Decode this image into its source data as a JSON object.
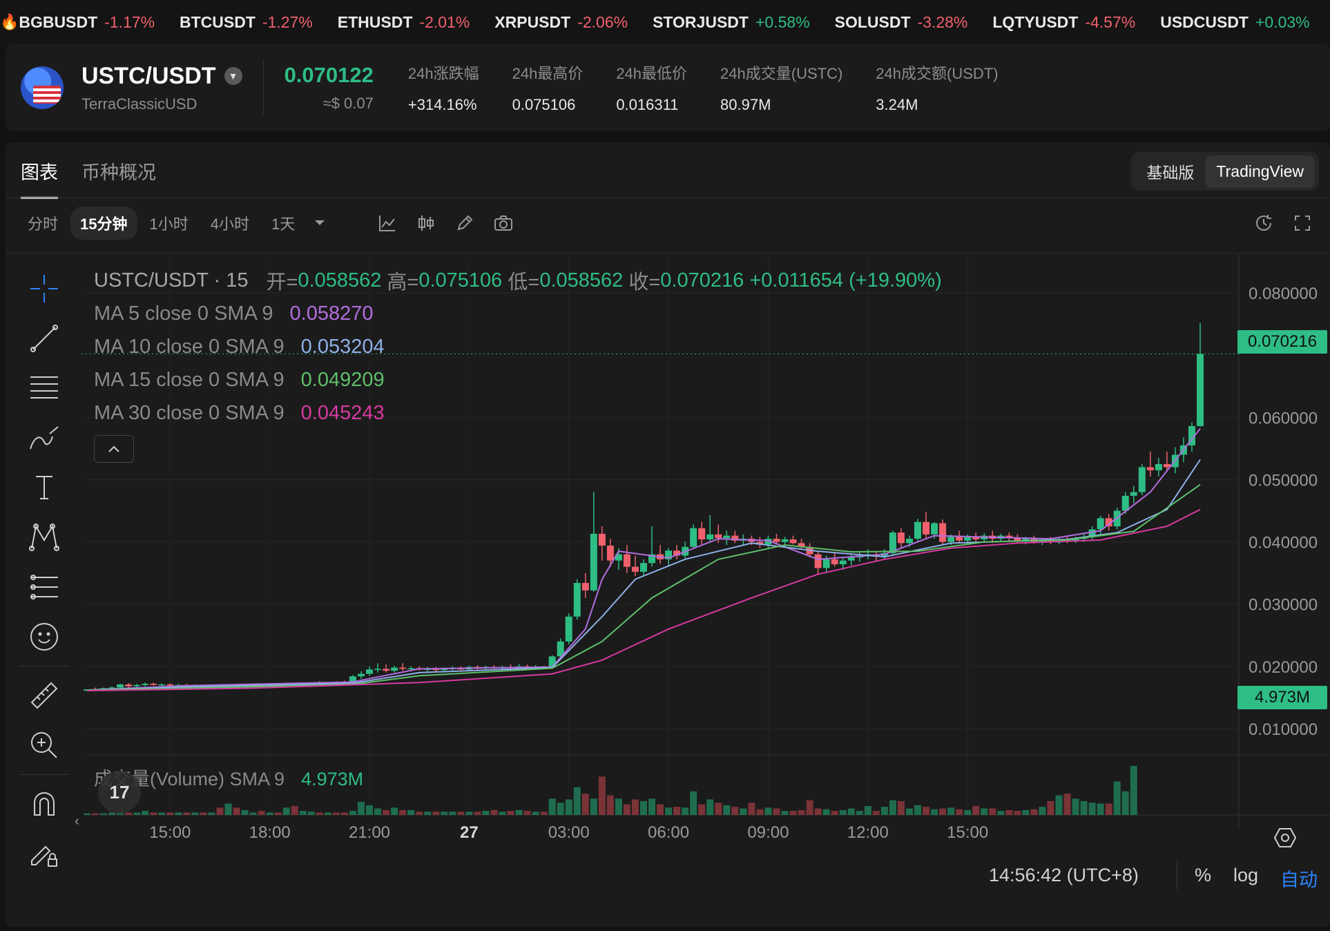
{
  "ticker": [
    {
      "symbol": "BGBUSDT",
      "change": "-1.17%",
      "dir": "down"
    },
    {
      "symbol": "BTCUSDT",
      "change": "-1.27%",
      "dir": "down"
    },
    {
      "symbol": "ETHUSDT",
      "change": "-2.01%",
      "dir": "down"
    },
    {
      "symbol": "XRPUSDT",
      "change": "-2.06%",
      "dir": "down"
    },
    {
      "symbol": "STORJUSDT",
      "change": "+0.58%",
      "dir": "up"
    },
    {
      "symbol": "SOLUSDT",
      "change": "-3.28%",
      "dir": "down"
    },
    {
      "symbol": "LQTYUSDT",
      "change": "-4.57%",
      "dir": "down"
    },
    {
      "symbol": "USDCUSDT",
      "change": "+0.03%",
      "dir": "up"
    }
  ],
  "header": {
    "pair": "USTC/USDT",
    "name": "TerraClassicUSD",
    "price": "0.070122",
    "price_usd": "≈$ 0.07",
    "stats": [
      {
        "label": "24h涨跌幅",
        "value": "+314.16%",
        "color": "up"
      },
      {
        "label": "24h最高价",
        "value": "0.075106"
      },
      {
        "label": "24h最低价",
        "value": "0.016311"
      },
      {
        "label": "24h成交量(USTC)",
        "value": "80.97M"
      },
      {
        "label": "24h成交额(USDT)",
        "value": "3.24M"
      }
    ]
  },
  "tabs": [
    "图表",
    "币种概况"
  ],
  "view_toggle": [
    "基础版",
    "TradingView"
  ],
  "intervals": [
    "分时",
    "15分钟",
    "1小时",
    "4小时",
    "1天"
  ],
  "legend": {
    "title": "USTC/USDT · 15",
    "ohlc": {
      "open_label": "开=",
      "open": "0.058562",
      "high_label": "高=",
      "high": "0.075106",
      "low_label": "低=",
      "low": "0.058562",
      "close_label": "收=",
      "close": "0.070216",
      "change": "+0.011654 (+19.90%)"
    },
    "mas": [
      {
        "label": "MA 5 close 0 SMA 9",
        "value": "0.058270",
        "color": "#b36ee0"
      },
      {
        "label": "MA 10 close 0 SMA 9",
        "value": "0.053204",
        "color": "#8fb0e8"
      },
      {
        "label": "MA 15 close 0 SMA 9",
        "value": "0.049209",
        "color": "#5fbf6a"
      },
      {
        "label": "MA 30 close 0 SMA 9",
        "value": "0.045243",
        "color": "#d63aa0"
      }
    ]
  },
  "volume_legend": {
    "label": "成交量(Volume) SMA 9",
    "value": "4.973M"
  },
  "price_tag": "0.070216",
  "volume_tag": "4.973M",
  "y_ticks": [
    "0.080000",
    "0.060000",
    "0.050000",
    "0.040000",
    "0.030000",
    "0.020000",
    "0.010000"
  ],
  "x_ticks": [
    "15:00",
    "18:00",
    "21:00",
    "27",
    "03:00",
    "06:00",
    "09:00",
    "12:00",
    "15:00"
  ],
  "bottom": {
    "time": "14:56:42 (UTC+8)",
    "percent": "%",
    "log": "log",
    "auto": "自动"
  },
  "chart_data": {
    "type": "candlestick",
    "ylim": [
      0.008,
      0.084
    ],
    "ticks": [
      0.08,
      0.06,
      0.05,
      0.04,
      0.03,
      0.02,
      0.01
    ],
    "candles": [
      [
        0.0161,
        0.0163,
        0.016,
        0.0163
      ],
      [
        0.0163,
        0.0166,
        0.016,
        0.0162
      ],
      [
        0.0162,
        0.0166,
        0.016,
        0.0165
      ],
      [
        0.0165,
        0.0168,
        0.0162,
        0.0166
      ],
      [
        0.0166,
        0.0172,
        0.0164,
        0.0171
      ],
      [
        0.0171,
        0.0173,
        0.0166,
        0.0168
      ],
      [
        0.0168,
        0.0172,
        0.0166,
        0.017
      ],
      [
        0.017,
        0.0174,
        0.0168,
        0.0172
      ],
      [
        0.0172,
        0.0174,
        0.0169,
        0.017
      ],
      [
        0.017,
        0.0173,
        0.0168,
        0.0171
      ],
      [
        0.0171,
        0.0173,
        0.0168,
        0.0169
      ],
      [
        0.0169,
        0.0172,
        0.0167,
        0.017
      ],
      [
        0.017,
        0.0172,
        0.0167,
        0.0168
      ],
      [
        0.0168,
        0.0171,
        0.0166,
        0.0169
      ],
      [
        0.0169,
        0.0171,
        0.0166,
        0.0167
      ],
      [
        0.0167,
        0.017,
        0.0165,
        0.0168
      ],
      [
        0.0168,
        0.017,
        0.0165,
        0.0166
      ],
      [
        0.0166,
        0.0169,
        0.0164,
        0.0167
      ],
      [
        0.0167,
        0.0169,
        0.0165,
        0.0166
      ],
      [
        0.0166,
        0.0169,
        0.0164,
        0.0168
      ],
      [
        0.0168,
        0.0171,
        0.0165,
        0.0169
      ],
      [
        0.0169,
        0.0171,
        0.0166,
        0.0167
      ],
      [
        0.0167,
        0.0172,
        0.0166,
        0.0171
      ],
      [
        0.0171,
        0.0173,
        0.0168,
        0.017
      ],
      [
        0.017,
        0.0174,
        0.0168,
        0.0172
      ],
      [
        0.0172,
        0.0174,
        0.0169,
        0.017
      ],
      [
        0.017,
        0.0173,
        0.0168,
        0.0171
      ],
      [
        0.0171,
        0.0174,
        0.0169,
        0.0173
      ],
      [
        0.0173,
        0.0176,
        0.017,
        0.0172
      ],
      [
        0.0172,
        0.0175,
        0.017,
        0.0174
      ],
      [
        0.0174,
        0.0176,
        0.0171,
        0.0173
      ],
      [
        0.0173,
        0.0177,
        0.017,
        0.0172
      ],
      [
        0.0172,
        0.0186,
        0.017,
        0.0184
      ],
      [
        0.0184,
        0.0192,
        0.018,
        0.0188
      ],
      [
        0.0188,
        0.02,
        0.0185,
        0.0195
      ],
      [
        0.0195,
        0.0205,
        0.019,
        0.0196
      ],
      [
        0.0196,
        0.0203,
        0.019,
        0.0193
      ],
      [
        0.0193,
        0.0201,
        0.019,
        0.0198
      ],
      [
        0.0198,
        0.0205,
        0.0193,
        0.0196
      ],
      [
        0.0196,
        0.02,
        0.0192,
        0.0197
      ],
      [
        0.0197,
        0.02,
        0.0193,
        0.0195
      ],
      [
        0.0195,
        0.0199,
        0.0192,
        0.0196
      ],
      [
        0.0196,
        0.0199,
        0.0192,
        0.0194
      ],
      [
        0.0194,
        0.0198,
        0.0191,
        0.0196
      ],
      [
        0.0196,
        0.02,
        0.0193,
        0.0197
      ],
      [
        0.0197,
        0.02,
        0.0194,
        0.0195
      ],
      [
        0.0195,
        0.0201,
        0.0193,
        0.0199
      ],
      [
        0.0199,
        0.0202,
        0.0195,
        0.0197
      ],
      [
        0.0197,
        0.0201,
        0.0194,
        0.0199
      ],
      [
        0.0199,
        0.0202,
        0.0196,
        0.0198
      ],
      [
        0.0198,
        0.0201,
        0.0195,
        0.0199
      ],
      [
        0.0199,
        0.0203,
        0.0196,
        0.0198
      ],
      [
        0.0198,
        0.0204,
        0.0195,
        0.02
      ],
      [
        0.02,
        0.0203,
        0.0196,
        0.0197
      ],
      [
        0.0197,
        0.0202,
        0.0195,
        0.0199
      ],
      [
        0.0199,
        0.0201,
        0.0196,
        0.0198
      ],
      [
        0.0198,
        0.0218,
        0.0196,
        0.0216
      ],
      [
        0.0216,
        0.0245,
        0.0212,
        0.024
      ],
      [
        0.024,
        0.0285,
        0.0235,
        0.028
      ],
      [
        0.028,
        0.034,
        0.0275,
        0.0334
      ],
      [
        0.0334,
        0.035,
        0.031,
        0.0322
      ],
      [
        0.0322,
        0.048,
        0.032,
        0.0413
      ],
      [
        0.0413,
        0.0425,
        0.037,
        0.0394
      ],
      [
        0.0394,
        0.0405,
        0.036,
        0.037
      ],
      [
        0.037,
        0.039,
        0.0355,
        0.038
      ],
      [
        0.038,
        0.0395,
        0.035,
        0.036
      ],
      [
        0.036,
        0.0378,
        0.0345,
        0.0352
      ],
      [
        0.0352,
        0.0372,
        0.0345,
        0.0366
      ],
      [
        0.0366,
        0.0425,
        0.036,
        0.038
      ],
      [
        0.038,
        0.0395,
        0.0365,
        0.0372
      ],
      [
        0.0372,
        0.039,
        0.036,
        0.0386
      ],
      [
        0.0386,
        0.0395,
        0.0372,
        0.0378
      ],
      [
        0.0378,
        0.04,
        0.0372,
        0.0392
      ],
      [
        0.0392,
        0.0428,
        0.0388,
        0.0422
      ],
      [
        0.0422,
        0.0432,
        0.0396,
        0.0404
      ],
      [
        0.0404,
        0.0443,
        0.0398,
        0.0412
      ],
      [
        0.0412,
        0.0428,
        0.0398,
        0.0406
      ],
      [
        0.0406,
        0.0418,
        0.0395,
        0.041
      ],
      [
        0.041,
        0.0418,
        0.0398,
        0.0402
      ],
      [
        0.0402,
        0.0412,
        0.0395,
        0.0405
      ],
      [
        0.0405,
        0.041,
        0.0395,
        0.04
      ],
      [
        0.04,
        0.0408,
        0.039,
        0.0396
      ],
      [
        0.0396,
        0.041,
        0.039,
        0.0405
      ],
      [
        0.0405,
        0.0413,
        0.0396,
        0.04
      ],
      [
        0.04,
        0.0408,
        0.0393,
        0.0404
      ],
      [
        0.0404,
        0.041,
        0.0396,
        0.0398
      ],
      [
        0.0398,
        0.0405,
        0.039,
        0.0392
      ],
      [
        0.0392,
        0.0398,
        0.0375,
        0.038
      ],
      [
        0.038,
        0.0385,
        0.0348,
        0.0358
      ],
      [
        0.0358,
        0.0378,
        0.035,
        0.0372
      ],
      [
        0.0372,
        0.0382,
        0.036,
        0.0364
      ],
      [
        0.0364,
        0.0375,
        0.0355,
        0.037
      ],
      [
        0.037,
        0.038,
        0.0362,
        0.0375
      ],
      [
        0.0375,
        0.0385,
        0.0368,
        0.0378
      ],
      [
        0.0378,
        0.0388,
        0.0372,
        0.038
      ],
      [
        0.038,
        0.0385,
        0.037,
        0.0377
      ],
      [
        0.0377,
        0.0388,
        0.0372,
        0.0382
      ],
      [
        0.0382,
        0.0418,
        0.0378,
        0.0415
      ],
      [
        0.0415,
        0.0422,
        0.039,
        0.0398
      ],
      [
        0.0398,
        0.041,
        0.0392,
        0.0405
      ],
      [
        0.0405,
        0.0437,
        0.04,
        0.0432
      ],
      [
        0.0432,
        0.0448,
        0.0405,
        0.0412
      ],
      [
        0.0412,
        0.0432,
        0.0405,
        0.043
      ],
      [
        0.043,
        0.0436,
        0.0395,
        0.04
      ],
      [
        0.04,
        0.0412,
        0.0395,
        0.0408
      ],
      [
        0.0408,
        0.0418,
        0.0398,
        0.0402
      ],
      [
        0.0402,
        0.0412,
        0.0396,
        0.0408
      ],
      [
        0.0408,
        0.0415,
        0.0398,
        0.0404
      ],
      [
        0.0404,
        0.0414,
        0.04,
        0.041
      ],
      [
        0.041,
        0.0418,
        0.0398,
        0.0405
      ],
      [
        0.0405,
        0.0413,
        0.04,
        0.041
      ],
      [
        0.041,
        0.0415,
        0.04,
        0.0406
      ],
      [
        0.0406,
        0.0412,
        0.0398,
        0.0402
      ],
      [
        0.0402,
        0.0408,
        0.0396,
        0.0405
      ],
      [
        0.0405,
        0.041,
        0.0397,
        0.04
      ],
      [
        0.04,
        0.0406,
        0.0395,
        0.0403
      ],
      [
        0.0403,
        0.0408,
        0.0396,
        0.0399
      ],
      [
        0.0399,
        0.0406,
        0.0396,
        0.0404
      ],
      [
        0.0404,
        0.041,
        0.0398,
        0.0402
      ],
      [
        0.0402,
        0.0408,
        0.0398,
        0.0405
      ],
      [
        0.0405,
        0.0412,
        0.04,
        0.0408
      ],
      [
        0.0408,
        0.0425,
        0.0402,
        0.042
      ],
      [
        0.042,
        0.0442,
        0.0412,
        0.0438
      ],
      [
        0.0438,
        0.0445,
        0.0418,
        0.0425
      ],
      [
        0.0425,
        0.0455,
        0.042,
        0.045
      ],
      [
        0.045,
        0.048,
        0.0445,
        0.0474
      ],
      [
        0.0474,
        0.049,
        0.0462,
        0.048
      ],
      [
        0.048,
        0.0525,
        0.0475,
        0.052
      ],
      [
        0.052,
        0.0545,
        0.0505,
        0.0515
      ],
      [
        0.0515,
        0.0535,
        0.0505,
        0.0525
      ],
      [
        0.0525,
        0.0545,
        0.0515,
        0.052
      ],
      [
        0.052,
        0.0552,
        0.051,
        0.054
      ],
      [
        0.054,
        0.0568,
        0.0528,
        0.0555
      ],
      [
        0.0555,
        0.0592,
        0.0545,
        0.0586
      ],
      [
        0.0586,
        0.0752,
        0.0585,
        0.0702
      ]
    ],
    "volumes": [
      0.2,
      0.2,
      0.2,
      0.3,
      0.4,
      0.3,
      0.3,
      0.5,
      0.3,
      0.3,
      0.3,
      0.3,
      0.3,
      0.3,
      0.3,
      0.3,
      0.9,
      1.4,
      0.9,
      0.6,
      0.3,
      0.5,
      0.3,
      0.3,
      0.9,
      1.1,
      0.5,
      0.4,
      0.3,
      0.3,
      0.3,
      0.3,
      0.5,
      1.6,
      1.2,
      0.8,
      0.6,
      0.9,
      0.6,
      0.6,
      0.4,
      0.4,
      0.4,
      0.4,
      0.4,
      0.4,
      0.4,
      0.4,
      0.5,
      0.6,
      0.4,
      0.5,
      0.6,
      0.5,
      0.4,
      0.4,
      2.0,
      1.5,
      1.9,
      3.4,
      2.6,
      2.0,
      4.7,
      2.4,
      2.0,
      1.3,
      1.9,
      1.7,
      2.0,
      1.3,
      0.9,
      1.0,
      0.9,
      2.9,
      1.3,
      1.9,
      1.5,
      1.2,
      1.0,
      0.8,
      1.5,
      0.7,
      0.9,
      0.8,
      0.5,
      0.5,
      0.6,
      1.8,
      0.8,
      0.7,
      0.5,
      0.6,
      0.8,
      0.5,
      1.1,
      0.5,
      1.0,
      1.8,
      1.7,
      0.8,
      1.2,
      1.0,
      0.7,
      0.8,
      0.9,
      0.7,
      0.6,
      1.1,
      0.8,
      0.8,
      0.5,
      0.6,
      0.5,
      0.6,
      0.7,
      1.0,
      1.7,
      2.4,
      2.6,
      2.0,
      1.7,
      1.5,
      1.4,
      1.4,
      4.1,
      2.9,
      6.0
    ],
    "ma": [
      {
        "name": "MA5",
        "color": "#b36ee0",
        "points": [
          [
            0,
            0.0162
          ],
          [
            12,
            0.0169
          ],
          [
            32,
            0.0175
          ],
          [
            40,
            0.0196
          ],
          [
            56,
            0.0199
          ],
          [
            60,
            0.026
          ],
          [
            62,
            0.034
          ],
          [
            64,
            0.0385
          ],
          [
            70,
            0.0374
          ],
          [
            76,
            0.0405
          ],
          [
            82,
            0.0402
          ],
          [
            88,
            0.0372
          ],
          [
            96,
            0.038
          ],
          [
            102,
            0.041
          ],
          [
            116,
            0.0405
          ],
          [
            122,
            0.0418
          ],
          [
            128,
            0.048
          ],
          [
            134,
            0.0582
          ]
        ]
      },
      {
        "name": "MA10",
        "color": "#8fb0e8",
        "points": [
          [
            0,
            0.0162
          ],
          [
            12,
            0.0167
          ],
          [
            32,
            0.0173
          ],
          [
            40,
            0.019
          ],
          [
            56,
            0.0198
          ],
          [
            62,
            0.028
          ],
          [
            66,
            0.034
          ],
          [
            72,
            0.0372
          ],
          [
            80,
            0.0398
          ],
          [
            88,
            0.0385
          ],
          [
            96,
            0.0376
          ],
          [
            104,
            0.0398
          ],
          [
            118,
            0.0404
          ],
          [
            124,
            0.0415
          ],
          [
            130,
            0.0452
          ],
          [
            134,
            0.0532
          ]
        ]
      },
      {
        "name": "MA15",
        "color": "#5fbf6a",
        "points": [
          [
            0,
            0.0162
          ],
          [
            12,
            0.0165
          ],
          [
            32,
            0.0171
          ],
          [
            40,
            0.0185
          ],
          [
            56,
            0.0197
          ],
          [
            62,
            0.024
          ],
          [
            68,
            0.031
          ],
          [
            76,
            0.0372
          ],
          [
            84,
            0.0395
          ],
          [
            92,
            0.0384
          ],
          [
            100,
            0.0385
          ],
          [
            108,
            0.04
          ],
          [
            118,
            0.0403
          ],
          [
            126,
            0.0417
          ],
          [
            134,
            0.0492
          ]
        ]
      },
      {
        "name": "MA30",
        "color": "#d63aa0",
        "points": [
          [
            0,
            0.0161
          ],
          [
            20,
            0.0165
          ],
          [
            40,
            0.0174
          ],
          [
            56,
            0.0188
          ],
          [
            62,
            0.021
          ],
          [
            70,
            0.026
          ],
          [
            80,
            0.031
          ],
          [
            88,
            0.0348
          ],
          [
            96,
            0.0372
          ],
          [
            104,
            0.039
          ],
          [
            112,
            0.0398
          ],
          [
            122,
            0.0403
          ],
          [
            130,
            0.0425
          ],
          [
            134,
            0.0452
          ]
        ]
      }
    ]
  }
}
